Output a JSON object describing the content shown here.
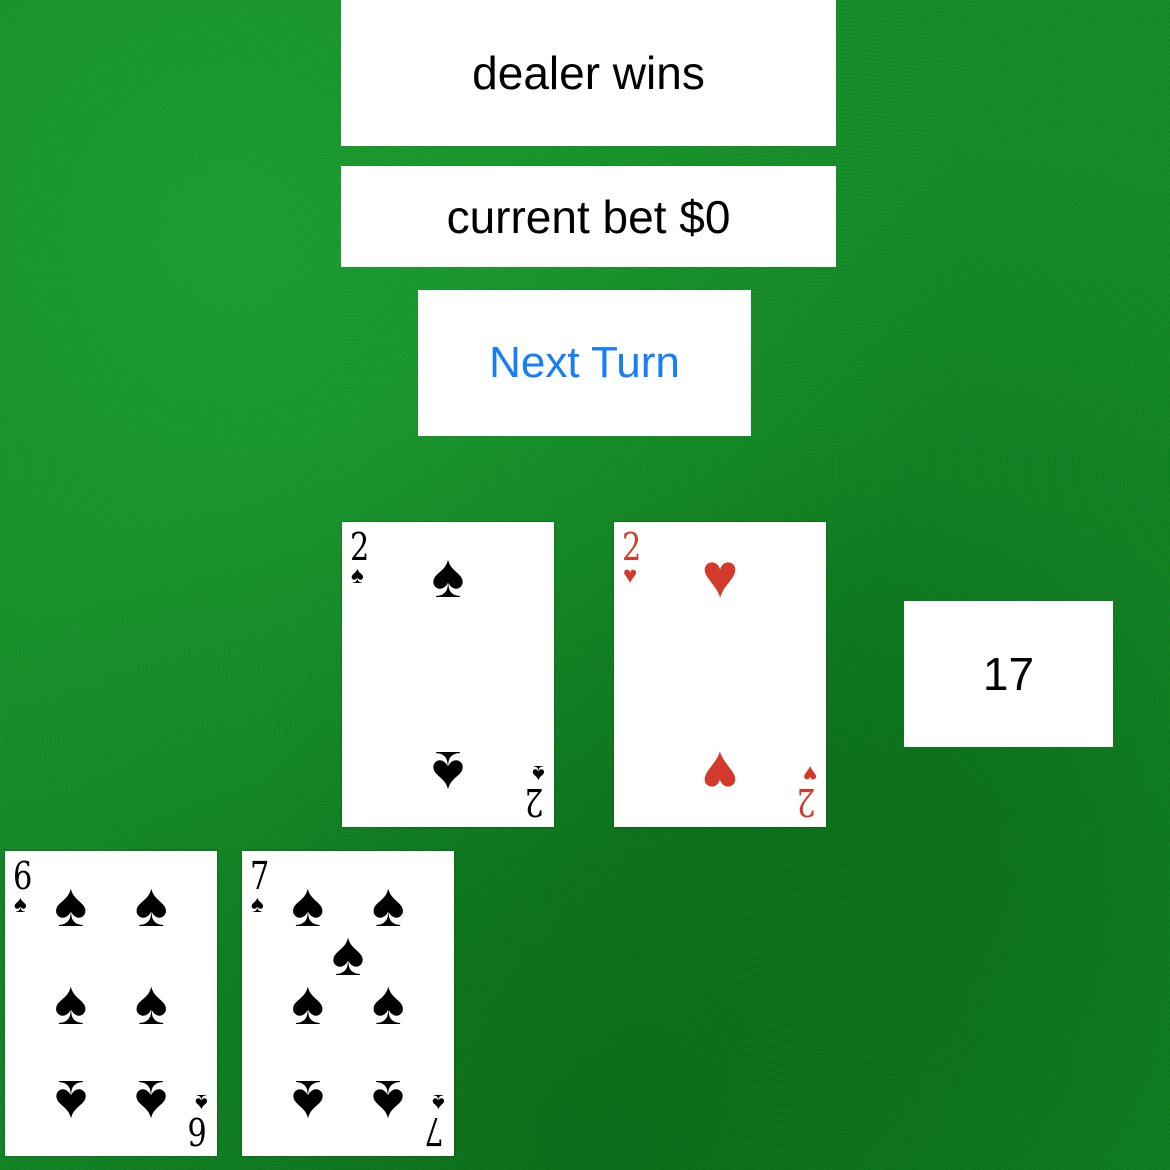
{
  "status_text": "dealer wins",
  "bet_text": "current bet $0",
  "next_turn_label": "Next Turn",
  "score": "17",
  "colors": {
    "button_text": "#147efb",
    "red_suit": "#d33a2c",
    "felt": "#138a26"
  },
  "dealer_hand": [
    {
      "rank": "2",
      "suit": "♠",
      "suit_name": "spades",
      "color": "black"
    },
    {
      "rank": "2",
      "suit": "♥",
      "suit_name": "hearts",
      "color": "red"
    }
  ],
  "player_hand": [
    {
      "rank": "6",
      "suit": "♠",
      "suit_name": "spades",
      "color": "black"
    },
    {
      "rank": "7",
      "suit": "♠",
      "suit_name": "spades",
      "color": "black"
    }
  ]
}
